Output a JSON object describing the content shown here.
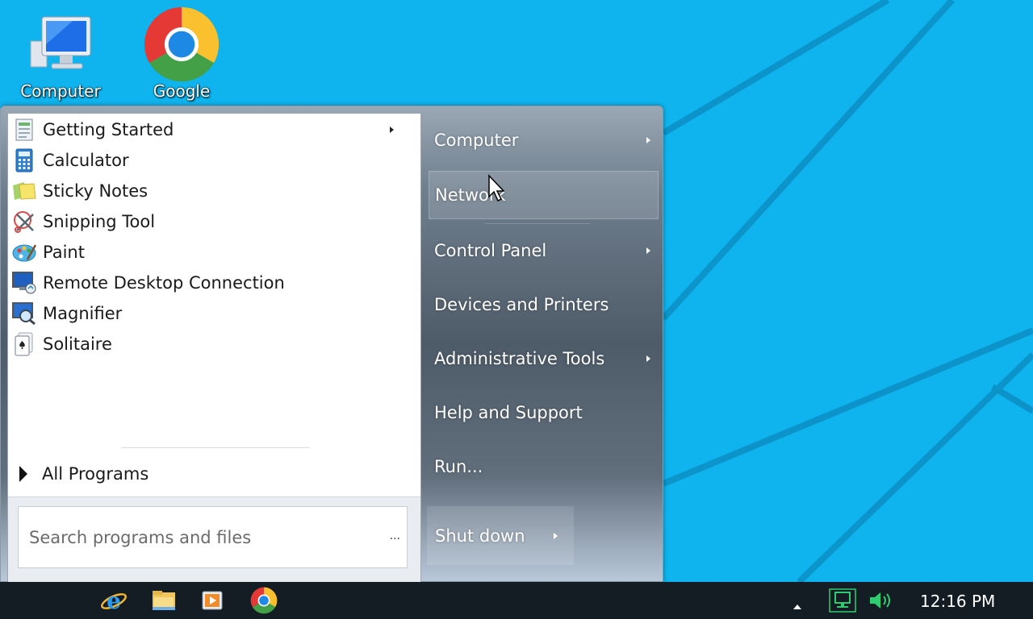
{
  "desktop": {
    "background_color": "#0fb4ee",
    "icons": [
      {
        "label": "Computer",
        "icon": "computer-icon"
      },
      {
        "label": "Google",
        "icon": "chrome-icon"
      }
    ]
  },
  "start_menu": {
    "programs": [
      {
        "label": "Getting Started",
        "icon": "getting-started-icon",
        "has_submenu": true
      },
      {
        "label": "Calculator",
        "icon": "calculator-icon"
      },
      {
        "label": "Sticky Notes",
        "icon": "sticky-notes-icon"
      },
      {
        "label": "Snipping Tool",
        "icon": "snipping-tool-icon"
      },
      {
        "label": "Paint",
        "icon": "paint-icon"
      },
      {
        "label": "Remote Desktop Connection",
        "icon": "remote-desktop-icon"
      },
      {
        "label": "Magnifier",
        "icon": "magnifier-icon"
      },
      {
        "label": "Solitaire",
        "icon": "solitaire-icon"
      }
    ],
    "all_programs_label": "All Programs",
    "search": {
      "placeholder": "Search programs and files",
      "value": "",
      "ellipsis": "..."
    },
    "right_pane": [
      {
        "label": "Computer",
        "has_submenu": true
      },
      {
        "label": "Network",
        "hovered": true
      },
      {
        "label": "Control Panel",
        "has_submenu": true
      },
      {
        "label": "Devices and Printers"
      },
      {
        "label": "Administrative Tools",
        "has_submenu": true
      },
      {
        "label": "Help and Support"
      },
      {
        "label": "Run..."
      }
    ],
    "shutdown_label": "Shut down"
  },
  "taskbar": {
    "pinned": [
      "internet-explorer-icon",
      "file-explorer-icon",
      "media-player-icon",
      "chrome-icon"
    ],
    "tray": [
      "show-hidden-icons-arrow",
      "network-icon",
      "volume-icon"
    ],
    "clock": "12:16 PM"
  }
}
